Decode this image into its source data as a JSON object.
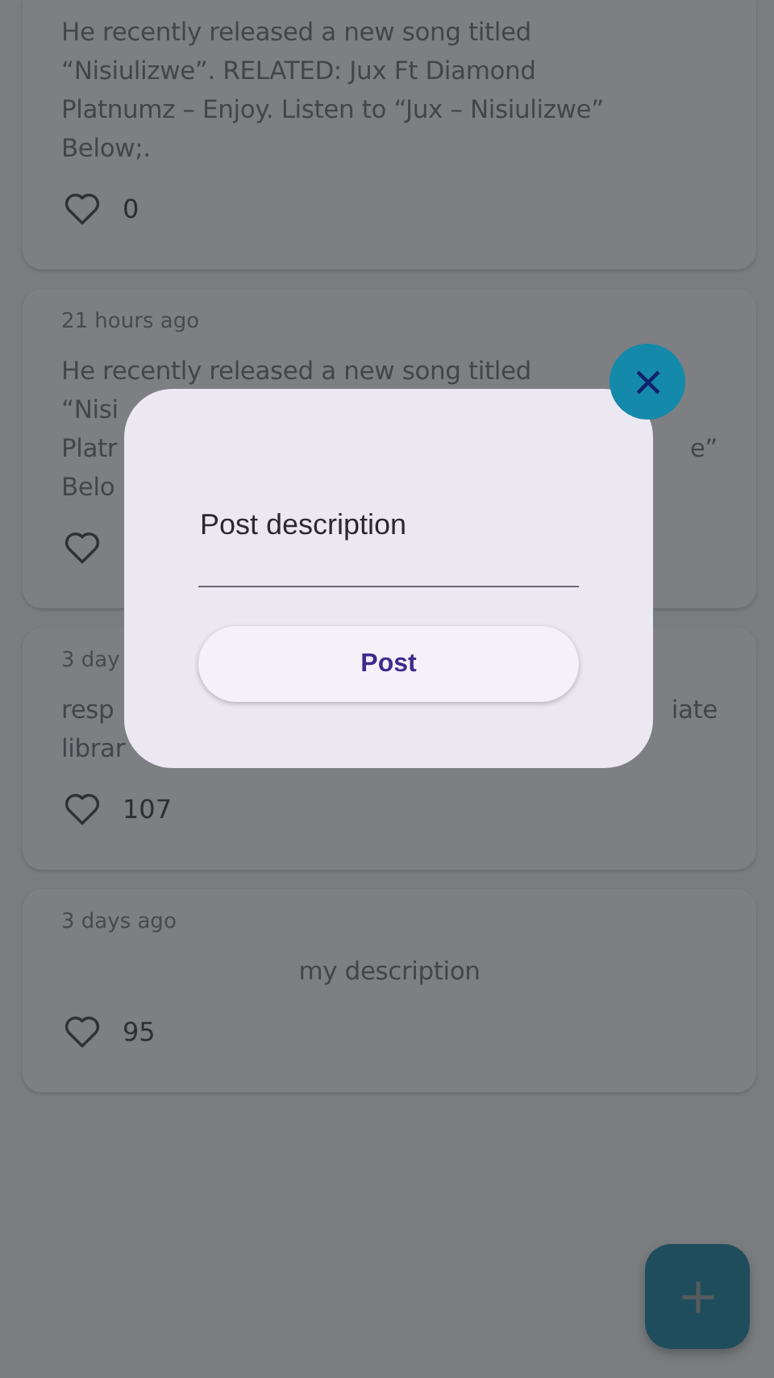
{
  "posts": [
    {
      "lines": [
        {
          "left": "He recently released a new song titled"
        },
        {
          "left": "“Nisiulizwe”. RELATED: Jux Ft Diamond"
        },
        {
          "left": "Platnumz – Enjoy. Listen to “Jux – Nisiulizwe”"
        },
        {
          "left": "Below;."
        }
      ],
      "likes": "0"
    },
    {
      "time": "21 hours ago",
      "lines": [
        {
          "left": "He recently released a new song titled"
        },
        {
          "left": "“Nisi"
        },
        {
          "left": "Platr",
          "right": "e”"
        },
        {
          "left": "Belo"
        }
      ]
    },
    {
      "time": "3 day",
      "lines": [
        {
          "left": "resp",
          "right": "iate"
        },
        {
          "left": "librar"
        }
      ],
      "likes": "107"
    },
    {
      "time": "3 days ago",
      "kind": "centered",
      "lines": [
        {
          "left": "my description"
        }
      ],
      "likes": "95"
    }
  ],
  "dialog": {
    "field": {
      "placeholder": "Post description"
    },
    "button": "Post"
  }
}
